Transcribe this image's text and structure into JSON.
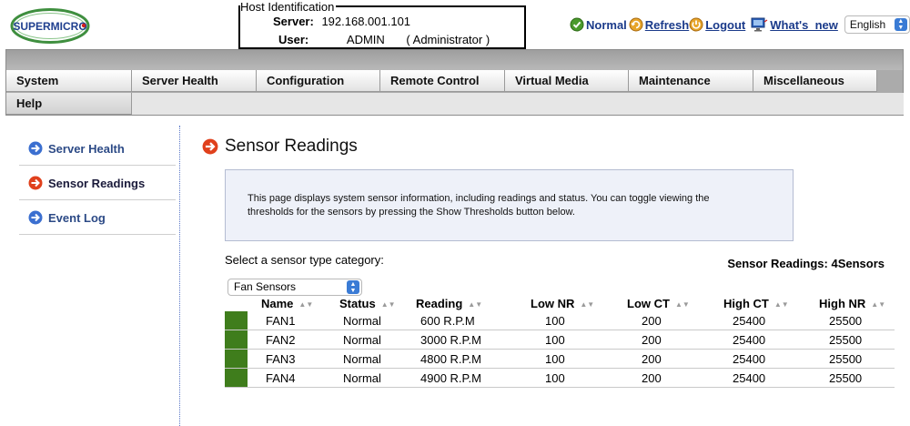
{
  "header": {
    "logo_text": "SUPERMICRO",
    "host_identification": {
      "legend": "Host Identification",
      "server_label": "Server:",
      "server_value": "192.168.001.101",
      "user_label": "User:",
      "user_value": "ADMIN",
      "user_role": "( Administrator )"
    },
    "status_label": "Normal",
    "refresh_label": "Refresh",
    "logout_label": "Logout",
    "whats_new_label": "What's_new",
    "language": "English"
  },
  "menu": {
    "row1": [
      "System",
      "Server Health",
      "Configuration",
      "Remote Control",
      "Virtual Media",
      "Maintenance",
      "Miscellaneous"
    ],
    "row2": [
      "Help"
    ]
  },
  "sidebar": {
    "items": [
      {
        "label": "Server Health",
        "active": false
      },
      {
        "label": "Sensor Readings",
        "active": true
      },
      {
        "label": "Event Log",
        "active": false
      }
    ]
  },
  "main": {
    "title": "Sensor Readings",
    "info_line1": "This page displays system sensor information, including readings and status. You can toggle viewing the",
    "info_line2": "thresholds for the sensors by pressing the Show Thresholds button below.",
    "select_label": "Select a sensor type category:",
    "sensor_count": "Sensor Readings: 4Sensors",
    "selected_category": "Fan Sensors",
    "columns": [
      "Name",
      "Status",
      "Reading",
      "Low NR",
      "Low CT",
      "High CT",
      "High NR"
    ],
    "rows": [
      {
        "name": "FAN1",
        "status": "Normal",
        "reading": "600 R.P.M",
        "low_nr": "100",
        "low_ct": "200",
        "high_ct": "25400",
        "high_nr": "25500"
      },
      {
        "name": "FAN2",
        "status": "Normal",
        "reading": "3000 R.P.M",
        "low_nr": "100",
        "low_ct": "200",
        "high_ct": "25400",
        "high_nr": "25500"
      },
      {
        "name": "FAN3",
        "status": "Normal",
        "reading": "4800 R.P.M",
        "low_nr": "100",
        "low_ct": "200",
        "high_ct": "25400",
        "high_nr": "25500"
      },
      {
        "name": "FAN4",
        "status": "Normal",
        "reading": "4900 R.P.M",
        "low_nr": "100",
        "low_ct": "200",
        "high_ct": "25400",
        "high_nr": "25500"
      }
    ]
  },
  "colors": {
    "status_ok": "#3f7d1c",
    "link_blue": "#1a3a8a",
    "nav_arrow_blue": "#3b6fd0",
    "nav_arrow_active": "#e0401c"
  },
  "icons": {
    "status": "check-circle-icon",
    "refresh": "refresh-icon",
    "logout": "logout-icon",
    "whats_new": "monitor-icon",
    "nav_arrow": "arrow-right-circle-icon"
  }
}
